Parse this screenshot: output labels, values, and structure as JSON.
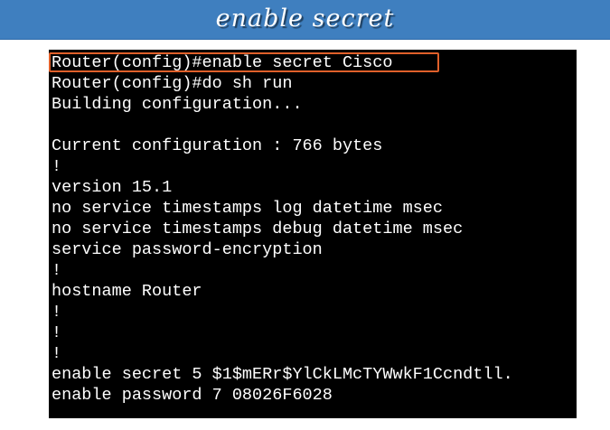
{
  "slide": {
    "title": "enable secret"
  },
  "terminal": {
    "lines": [
      "Router(config)#enable secret Cisco",
      "Router(config)#do sh run",
      "Building configuration...",
      "",
      "Current configuration : 766 bytes",
      "!",
      "version 15.1",
      "no service timestamps log datetime msec",
      "no service timestamps debug datetime msec",
      "service password-encryption",
      "!",
      "hostname Router",
      "!",
      "!",
      "!",
      "enable secret 5 $1$mERr$YlCkLMcTYWwkF1Ccndtll.",
      "enable password 7 08026F6028"
    ],
    "highlight_color": "#e0602a"
  }
}
